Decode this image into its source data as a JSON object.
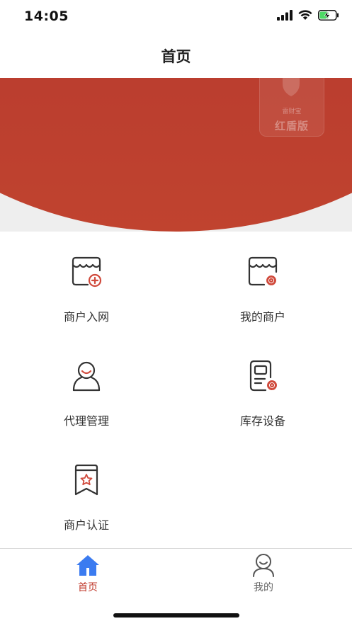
{
  "status_bar": {
    "time": "14:05",
    "battery_level": 0.55
  },
  "nav": {
    "title": "首页"
  },
  "banner": {
    "shield_small_text": "雷财宝",
    "shield_edition_text": "红盾版",
    "colors": {
      "red": "#c0432f",
      "bg": "#eeeeee"
    }
  },
  "menu": {
    "items": [
      {
        "label": "商户入网",
        "icon": "shop-add-icon"
      },
      {
        "label": "我的商户",
        "icon": "shop-settings-icon"
      },
      {
        "label": "代理管理",
        "icon": "agent-icon"
      },
      {
        "label": "库存设备",
        "icon": "device-settings-icon"
      },
      {
        "label": "商户认证",
        "icon": "bookmark-star-icon"
      }
    ]
  },
  "tab_bar": {
    "active_color": "#c0392b",
    "tabs": [
      {
        "label": "首页",
        "icon": "home-icon",
        "active": true
      },
      {
        "label": "我的",
        "icon": "profile-icon",
        "active": false
      }
    ]
  }
}
